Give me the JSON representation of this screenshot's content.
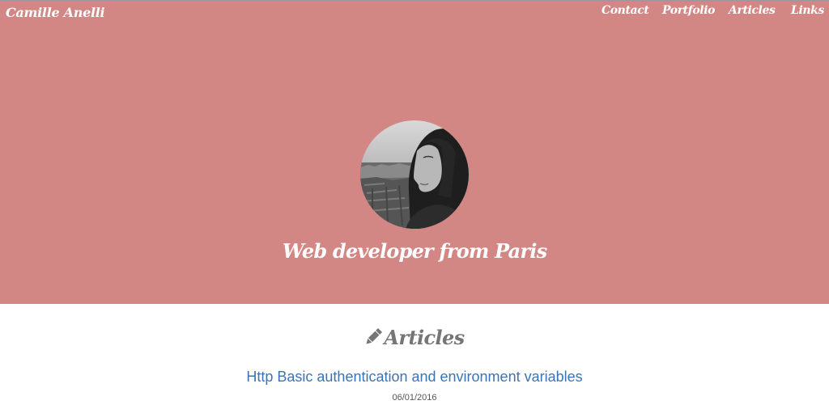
{
  "header": {
    "brand": "Camille Anelli",
    "nav": [
      {
        "label": "Contact"
      },
      {
        "label": "Portfolio"
      },
      {
        "label": "Articles"
      },
      {
        "label": "Links"
      }
    ]
  },
  "hero": {
    "tagline": "Web developer from Paris",
    "background_color": "#d38784",
    "avatar": "profile-photo"
  },
  "articles_section": {
    "heading": "Articles",
    "icon": "pencil-icon",
    "items": [
      {
        "title": "Http Basic authentication and environment variables",
        "date": "06/01/2016"
      }
    ]
  },
  "colors": {
    "link": "#3a74b4",
    "heading": "#757575",
    "date": "#555555"
  }
}
